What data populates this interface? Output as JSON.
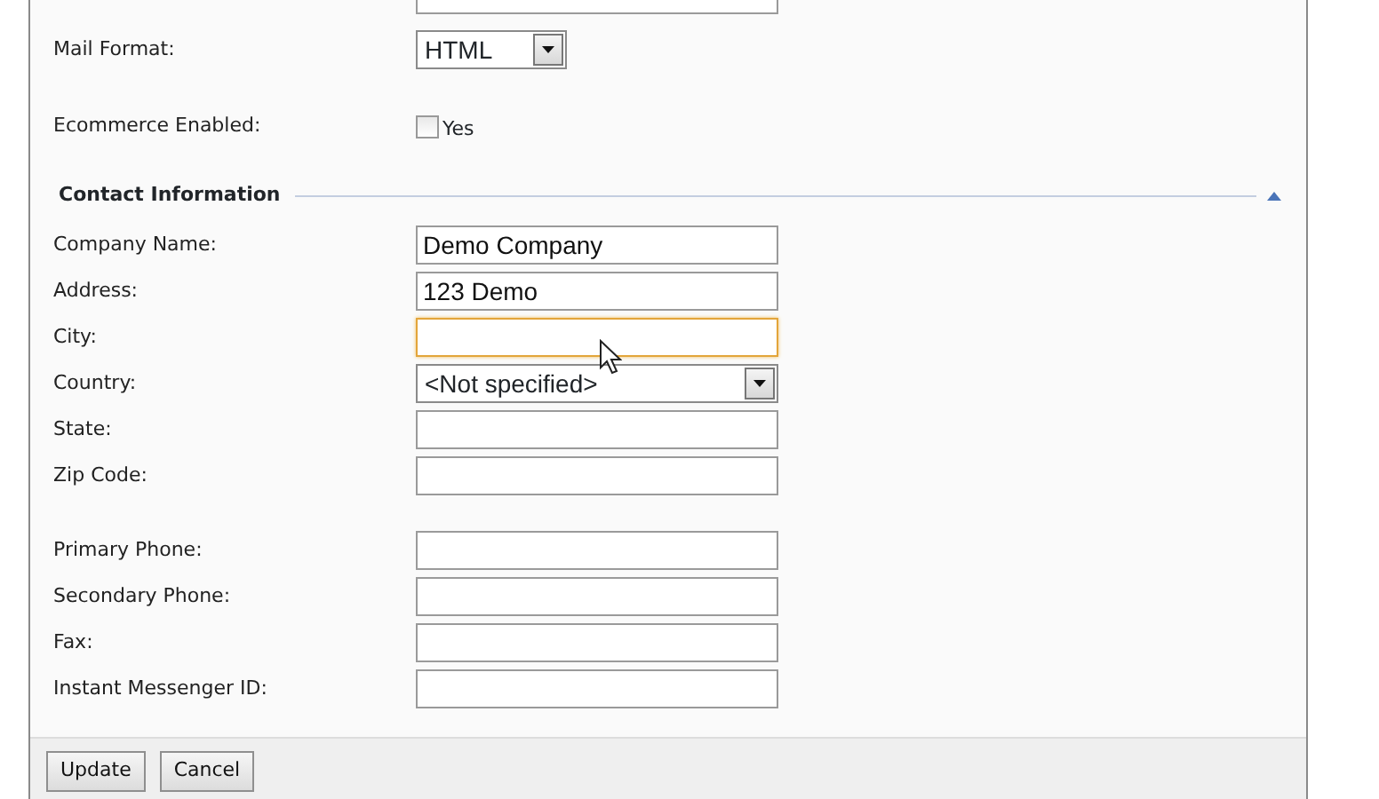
{
  "top_fields": [
    {
      "kind": "cut"
    },
    {
      "kind": "select",
      "label": "Mail Format:",
      "value": "HTML"
    },
    {
      "kind": "checkbox",
      "label": "Ecommerce Enabled:",
      "checked": false,
      "option": "Yes"
    }
  ],
  "contact": {
    "title": "Contact Information",
    "expanded": true,
    "groups": [
      [
        {
          "kind": "text",
          "label": "Company Name:",
          "value": "Demo Company",
          "focused": false
        },
        {
          "kind": "text",
          "label": "Address:",
          "value": "123 Demo",
          "focused": false
        },
        {
          "kind": "text",
          "label": "City:",
          "focused": true
        },
        {
          "kind": "select",
          "label": "Country:",
          "value": "<Not specified>"
        },
        {
          "kind": "text",
          "label": "State:",
          "focused": false
        },
        {
          "kind": "text",
          "label": "Zip Code:",
          "focused": false
        }
      ],
      [
        {
          "kind": "text",
          "label": "Primary Phone:",
          "focused": false
        },
        {
          "kind": "text",
          "label": "Secondary Phone:",
          "focused": false
        },
        {
          "kind": "text",
          "label": "Fax:",
          "focused": false
        },
        {
          "kind": "text",
          "label": "Instant Messenger ID:",
          "focused": false
        }
      ]
    ]
  },
  "buttons": [
    "Update",
    "Cancel"
  ]
}
